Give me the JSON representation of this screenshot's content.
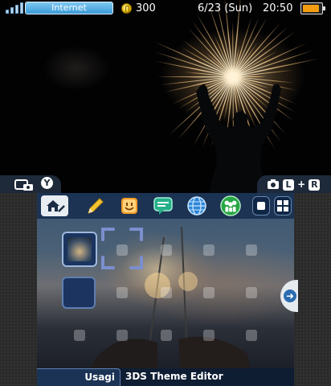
{
  "top_screen": {
    "status_bar": {
      "connection_label": "Internet",
      "play_coins": "300",
      "date": "6/23 (Sun)",
      "time": "20:50"
    },
    "left_tab": {
      "buttons": [
        "Y"
      ]
    },
    "right_tab": {
      "buttons": [
        "L",
        "+",
        "R"
      ]
    },
    "icons": [
      "signal-icon",
      "coin-icon",
      "battery-icon",
      "camera-icon"
    ]
  },
  "bottom_screen": {
    "menu_icons": [
      "home-settings-icon",
      "pencil-icon",
      "smiley-icon",
      "chat-icon",
      "globe-icon",
      "friends-icon",
      "square-icon",
      "grid-icon"
    ],
    "footer": {
      "author": "Usagi",
      "title": "3DS Theme Editor"
    }
  },
  "colors": {
    "statusbar_pill": "#3a9ad6",
    "menubar": "#193050",
    "tab_bg": "#1e2a3a",
    "battery": "#f39c12",
    "footer_bg": "#0f1d33"
  }
}
